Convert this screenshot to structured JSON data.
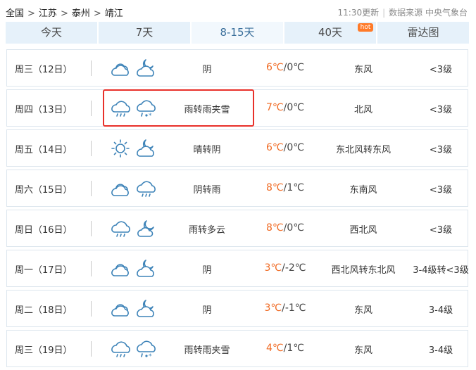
{
  "breadcrumb": {
    "items": [
      "全国",
      "江苏",
      "泰州",
      "靖江"
    ],
    "separator": ">"
  },
  "meta": {
    "update_time": "11:30更新",
    "source": "数据来源 中央气象台"
  },
  "tabs": [
    {
      "label": "今天",
      "active": false
    },
    {
      "label": "7天",
      "active": false
    },
    {
      "label": "8-15天",
      "active": true
    },
    {
      "label": "40天",
      "active": false,
      "badge": "hot"
    },
    {
      "label": "雷达图",
      "active": false
    }
  ],
  "colors": {
    "accent": "#3d83b8",
    "high_temp": "#f06a23",
    "tab_bg": "#e6f1fa",
    "highlight": "#e8302a"
  },
  "forecast": [
    {
      "day": "周三（12日）",
      "icon1": "cloudy-icon",
      "icon2": "cloudy-night-icon",
      "weather": "阴",
      "high": "6℃",
      "low": "/0℃",
      "wind": "东风",
      "level": "<3级"
    },
    {
      "day": "周四（13日）",
      "icon1": "rain-icon",
      "icon2": "sleet-icon",
      "weather": "雨转雨夹雪",
      "high": "7℃",
      "low": "/0℃",
      "wind": "北风",
      "level": "<3级"
    },
    {
      "day": "周五（14日）",
      "icon1": "sunny-icon",
      "icon2": "cloudy-night-icon",
      "weather": "晴转阴",
      "high": "6℃",
      "low": "/0℃",
      "wind": "东北风转东风",
      "level": "<3级"
    },
    {
      "day": "周六（15日）",
      "icon1": "cloudy-icon",
      "icon2": "rain-icon",
      "weather": "阴转雨",
      "high": "8℃",
      "low": "/1℃",
      "wind": "东南风",
      "level": "<3级"
    },
    {
      "day": "周日（16日）",
      "icon1": "rain-icon",
      "icon2": "partly-cloudy-night-icon",
      "weather": "雨转多云",
      "high": "8℃",
      "low": "/0℃",
      "wind": "西北风",
      "level": "<3级"
    },
    {
      "day": "周一（17日）",
      "icon1": "cloudy-icon",
      "icon2": "cloudy-night-icon",
      "weather": "阴",
      "high": "3℃",
      "low": "/-2℃",
      "wind": "西北风转东北风",
      "level": "3-4级转<3级"
    },
    {
      "day": "周二（18日）",
      "icon1": "cloudy-icon",
      "icon2": "cloudy-night-icon",
      "weather": "阴",
      "high": "3℃",
      "low": "/-1℃",
      "wind": "东风",
      "level": "3-4级"
    },
    {
      "day": "周三（19日）",
      "icon1": "rain-icon",
      "icon2": "sleet-icon",
      "weather": "雨转雨夹雪",
      "high": "4℃",
      "low": "/1℃",
      "wind": "东风",
      "level": "3-4级"
    }
  ]
}
